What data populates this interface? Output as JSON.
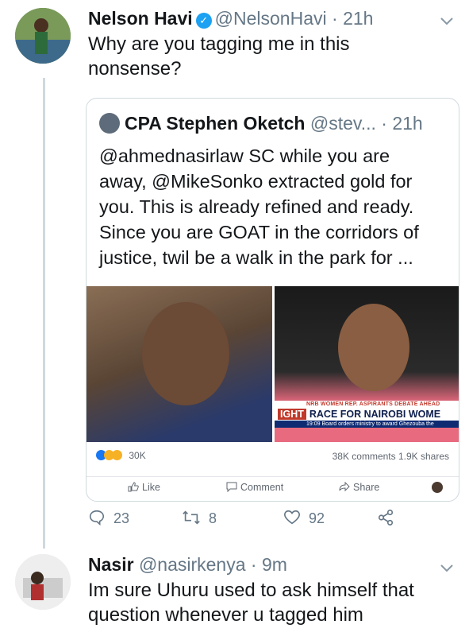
{
  "tweet1": {
    "name": "Nelson Havi",
    "handle": "@NelsonHavi",
    "time": "· 21h",
    "text_line1": "Why are you tagging me in this",
    "text_line2": "nonsense?"
  },
  "quote": {
    "name": "CPA Stephen Oketch",
    "handle": "@stev...",
    "time": "· 21h",
    "lines": [
      "@ahmednasirlaw SC while you are",
      "away, @MikeSonko extracted gold for",
      "you. This is already refined and ready.",
      "Since you are GOAT in the corridors of",
      "justice, twil be a walk in the park for ..."
    ],
    "ticker_top": "NRB WOMEN REP. ASPIRANTS DEBATE AHEAD",
    "ticker_tag": "IGHT",
    "ticker_main": "RACE FOR NAIROBI WOME",
    "ticker_time": "19:09",
    "ticker_sub": "Board orders ministry to award Ghezouba the",
    "reactions": "30K",
    "comments_shares": "38K comments  1.9K shares",
    "like": "Like",
    "comment": "Comment",
    "share": "Share"
  },
  "actions": {
    "replies": "23",
    "retweets": "8",
    "likes": "92"
  },
  "tweet2": {
    "name": "Nasir",
    "handle": "@nasirkenya",
    "time": "· 9m",
    "text_line1": "Im sure Uhuru used to ask himself that",
    "text_line2": "question whenever u tagged him"
  },
  "colors": {
    "verified": "#1da1f2",
    "secondary_text": "#657786",
    "border": "#cfd9de"
  }
}
